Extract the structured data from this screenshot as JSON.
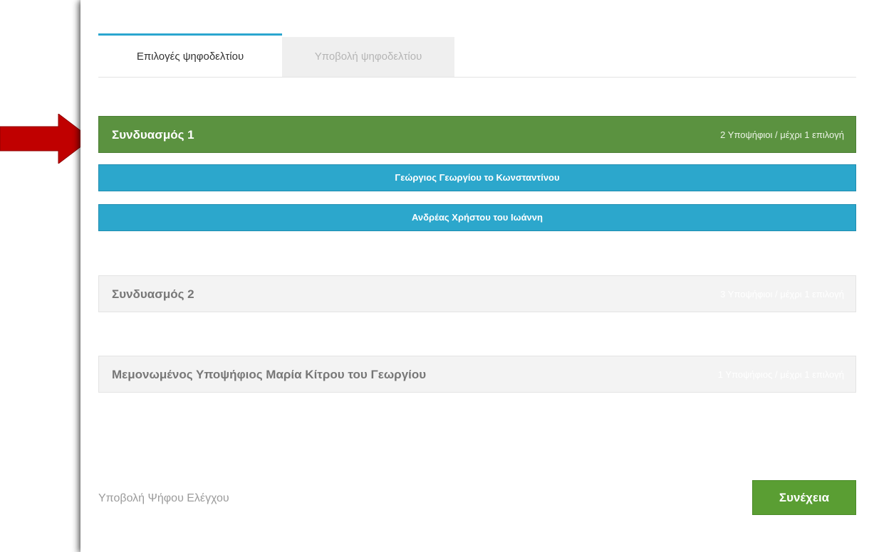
{
  "tabs": {
    "ballot_options": "Επιλογές ψηφοδελτίου",
    "ballot_submit": "Υποβολή ψηφοδελτίου"
  },
  "groups": [
    {
      "title": "Συνδυασμός 1",
      "meta": "2 Υποψήφιοι / μέχρι 1 επιλογή",
      "candidates": [
        "Γεώργιος Γεωργίου το Κωνσταντίνου",
        "Ανδρέας Χρήστου του Ιωάννη"
      ]
    },
    {
      "title": "Συνδυασμός 2",
      "meta": "3 Υποψήφιοι / μέχρι 1 επιλογή"
    },
    {
      "title": "Μεμονωμένος Υποψήφιος Μαρία Κίτρου του Γεωργίου",
      "meta": "1 Υποψήφιος / μέχρι 1 επιλογή"
    }
  ],
  "footer": {
    "control_vote": "Υποβολή Ψήφου Ελέγχου",
    "continue": "Συνέχεια"
  },
  "colors": {
    "selected_group": "#5b9240",
    "candidate": "#2ca7cc",
    "continue": "#5a9e33",
    "annotation_arrow": "#c00000",
    "active_tab_accent": "#2aa6cf"
  },
  "icons": {
    "annotation": "right-arrow-icon"
  }
}
